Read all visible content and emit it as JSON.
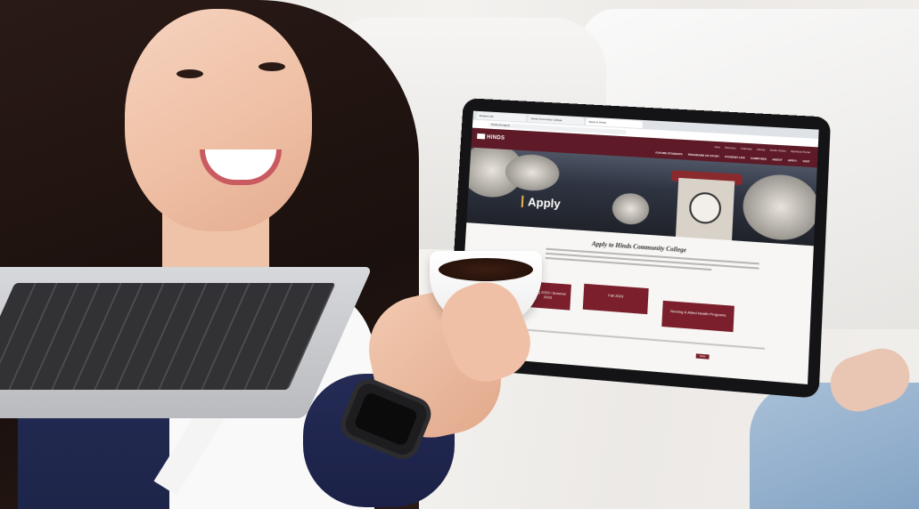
{
  "scene": {
    "colors": {
      "maroon": "#7a1f2b",
      "sofa": "#f3f2ef",
      "cardigan": "#222a52"
    }
  },
  "laptop": {
    "browser": {
      "tabs": [
        "Student Life",
        "Hinds Community College",
        "Apply to Hinds"
      ],
      "url": "hinds.edu/apply"
    },
    "site": {
      "logo": "HINDS",
      "utility_nav": [
        "Give",
        "Directory",
        "Calendar",
        "Library",
        "Hinds Online",
        "MyHinds Portal"
      ],
      "main_nav": [
        "FUTURE STUDENTS",
        "PROGRAMS OF STUDY",
        "STUDENT LIFE",
        "CAMPUSES",
        "ABOUT",
        "APPLY",
        "VISIT"
      ],
      "hero_title": "Apply",
      "content_title": "Apply to Hinds Community College",
      "cards": [
        "Spring 2023 / Summer 2023",
        "Fall 2023",
        "Nursing & Allied Health Programs"
      ],
      "small_button": "Apply"
    }
  }
}
